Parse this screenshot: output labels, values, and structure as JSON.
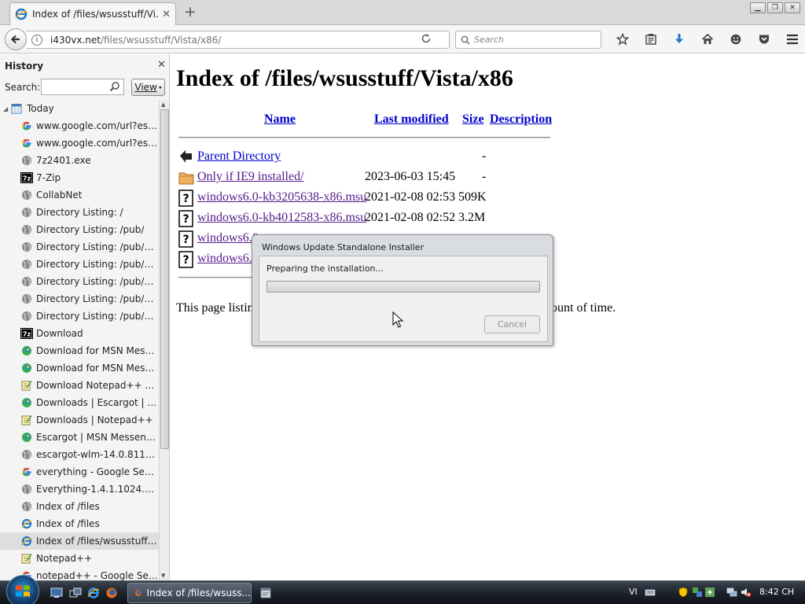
{
  "browser": {
    "tab_title": "Index of /files/wsusstuff/Vi...",
    "url_host": "i430vx.net",
    "url_path": "/files/wsusstuff/Vista/x86/",
    "search_placeholder": "Search"
  },
  "sidebar": {
    "title": "History",
    "search_label": "Search:",
    "view_label": "View",
    "today_label": "Today",
    "items": [
      {
        "label": "www.google.com/url?esrc...",
        "icon": "google-icon"
      },
      {
        "label": "www.google.com/url?esrc...",
        "icon": "google-icon"
      },
      {
        "label": "7z2401.exe",
        "icon": "globe-icon"
      },
      {
        "label": "7-Zip",
        "icon": "7zip-icon"
      },
      {
        "label": "CollabNet",
        "icon": "globe-icon"
      },
      {
        "label": "Directory Listing: /",
        "icon": "globe-icon"
      },
      {
        "label": "Directory Listing: /pub/",
        "icon": "globe-icon"
      },
      {
        "label": "Directory Listing: /pub/fire...",
        "icon": "globe-icon"
      },
      {
        "label": "Directory Listing: /pub/fire...",
        "icon": "globe-icon"
      },
      {
        "label": "Directory Listing: /pub/fire...",
        "icon": "globe-icon"
      },
      {
        "label": "Directory Listing: /pub/fire...",
        "icon": "globe-icon"
      },
      {
        "label": "Directory Listing: /pub/fire...",
        "icon": "globe-icon"
      },
      {
        "label": "Download",
        "icon": "7zip-icon"
      },
      {
        "label": "Download for MSN Messe...",
        "icon": "escargot-icon"
      },
      {
        "label": "Download for MSN Messe...",
        "icon": "escargot-icon"
      },
      {
        "label": "Download Notepad++ v8....",
        "icon": "notepad-icon"
      },
      {
        "label": "Downloads | Escargot | MS...",
        "icon": "escargot-icon"
      },
      {
        "label": "Downloads | Notepad++",
        "icon": "notepad-icon"
      },
      {
        "label": "Escargot | MSN Messenger...",
        "icon": "escargot-icon"
      },
      {
        "label": "escargot-wlm-14.0.8117.04...",
        "icon": "globe-icon"
      },
      {
        "label": "everything - Google Search",
        "icon": "google-icon"
      },
      {
        "label": "Everything-1.4.1.1024.x86-...",
        "icon": "globe-icon"
      },
      {
        "label": "Index of /files",
        "icon": "globe-icon"
      },
      {
        "label": "Index of /files",
        "icon": "ie-icon"
      },
      {
        "label": "Index of /files/wsusstuff/Vi...",
        "icon": "ie-icon",
        "selected": true
      },
      {
        "label": "Notepad++",
        "icon": "notepad-icon"
      },
      {
        "label": "notepad++ - Google Search",
        "icon": "google-icon"
      }
    ]
  },
  "page": {
    "heading": "Index of /files/wsusstuff/Vista/x86",
    "columns": [
      "Name",
      "Last modified",
      "Size",
      "Description"
    ],
    "rows": [
      {
        "name": "Parent Directory",
        "date": "",
        "size": "-",
        "icon": "back-arrow-icon"
      },
      {
        "name": "Only if IE9 installed/",
        "date": "2023-06-03 15:45",
        "size": "-",
        "icon": "folder-icon"
      },
      {
        "name": "windows6.0-kb3205638-x86.msu",
        "date": "2021-02-08 02:53",
        "size": "509K",
        "icon": "unknown-file-icon"
      },
      {
        "name": "windows6.0-kb4012583-x86.msu",
        "date": "2021-02-08 02:52",
        "size": "3.2M",
        "icon": "unknown-file-icon"
      },
      {
        "name": "windows6.0",
        "date": "",
        "size": "",
        "icon": "unknown-file-icon"
      },
      {
        "name": "windows6.0",
        "date": "",
        "size": "",
        "icon": "unknown-file-icon"
      }
    ],
    "note_left": "This page listing",
    "note_right": "ount of time."
  },
  "dialog": {
    "title": "Windows Update Standalone Installer",
    "message": "Preparing the installation...",
    "progress": 0.0,
    "cancel_label": "Cancel"
  },
  "taskbar": {
    "task_label": "Index of /files/wsuss...",
    "language": "VI",
    "clock": "8:42 CH"
  },
  "colors": {
    "link": "#0000cc",
    "visited_link": "#551a8b",
    "taskbar": "#1c2028",
    "progress": "#2aa82a"
  }
}
